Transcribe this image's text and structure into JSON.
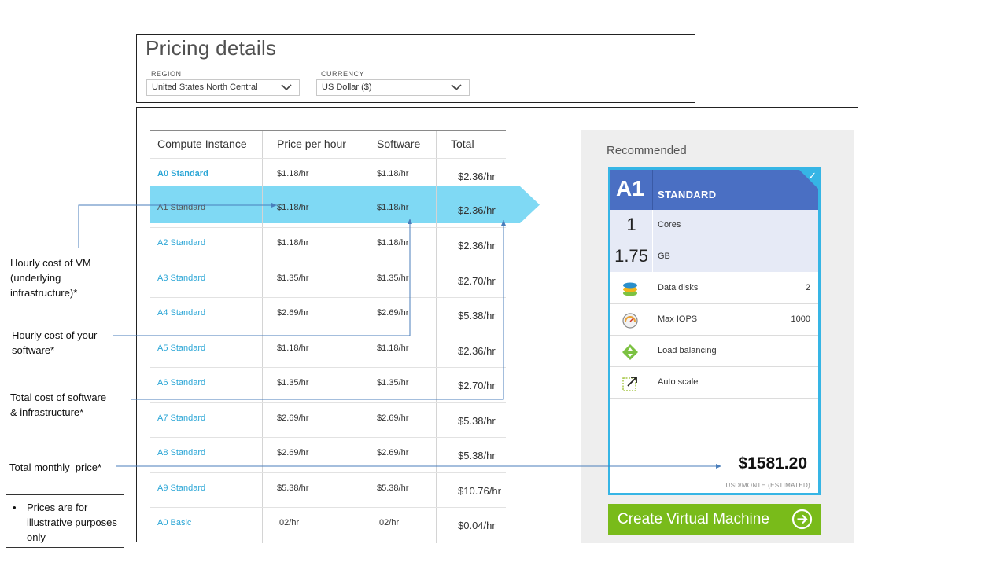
{
  "pricing_details": {
    "title": "Pricing details",
    "region_label": "REGION",
    "region_value": "United States North Central",
    "currency_label": "CURRENCY",
    "currency_value": "US Dollar ($)"
  },
  "table": {
    "headers": [
      "Compute Instance",
      "Price per hour",
      "Software",
      "Total"
    ],
    "rows": [
      {
        "name": "A0 Standard",
        "price": "$1.18/hr",
        "software": "$1.18/hr",
        "total": "$2.36/hr"
      },
      {
        "name": "A1 Standard",
        "price": "$1.18/hr",
        "software": "$1.18/hr",
        "total": "$2.36/hr"
      },
      {
        "name": "A2 Standard",
        "price": "$1.18/hr",
        "software": "$1.18/hr",
        "total": "$2.36/hr"
      },
      {
        "name": "A3 Standard",
        "price": "$1.35/hr",
        "software": "$1.35/hr",
        "total": "$2.70/hr"
      },
      {
        "name": "A4 Standard",
        "price": "$2.69/hr",
        "software": "$2.69/hr",
        "total": "$5.38/hr"
      },
      {
        "name": "A5 Standard",
        "price": "$1.18/hr",
        "software": "$1.18/hr",
        "total": "$2.36/hr"
      },
      {
        "name": "A6 Standard",
        "price": "$1.35/hr",
        "software": "$1.35/hr",
        "total": "$2.70/hr"
      },
      {
        "name": "A7 Standard",
        "price": "$2.69/hr",
        "software": "$2.69/hr",
        "total": "$5.38/hr"
      },
      {
        "name": "A8 Standard",
        "price": "$2.69/hr",
        "software": "$2.69/hr",
        "total": "$5.38/hr"
      },
      {
        "name": "A9 Standard",
        "price": "$5.38/hr",
        "software": "$5.38/hr",
        "total": "$10.76/hr"
      },
      {
        "name": "A0 Basic",
        "price": ".02/hr",
        "software": ".02/hr",
        "total": "$0.04/hr"
      }
    ]
  },
  "recommended": {
    "title": "Recommended",
    "size": "A1",
    "tier": "STANDARD",
    "cores_value": "1",
    "cores_label": "Cores",
    "memory_value": "1.75",
    "memory_label": "GB",
    "features": [
      {
        "label": "Data disks",
        "value": "2",
        "icon": "data-disks-icon"
      },
      {
        "label": "Max IOPS",
        "value": "1000",
        "icon": "gauge-icon"
      },
      {
        "label": "Load balancing",
        "value": "",
        "icon": "load-balancing-icon"
      },
      {
        "label": "Auto scale",
        "value": "",
        "icon": "auto-scale-icon"
      }
    ],
    "price": "$1581.20",
    "price_unit": "USD/MONTH (ESTIMATED)",
    "create_button": "Create Virtual Machine"
  },
  "annotations": {
    "vm_cost": [
      "Hourly cost of VM",
      "(underlying",
      "infrastructure)*"
    ],
    "software_cost": [
      "Hourly cost of your",
      "software*"
    ],
    "total_cost": [
      "Total cost of software",
      "& infrastructure*"
    ],
    "monthly_price": "Total monthly  price*",
    "note_bullet": "•",
    "note": "Prices are for illustrative purposes only"
  },
  "colors": {
    "accent_blue": "#36b5e5",
    "highlight": "#7fd9f4",
    "card_header": "#4a6fc3",
    "button_green": "#79bb1a",
    "link_blue": "#2ba6d6"
  }
}
